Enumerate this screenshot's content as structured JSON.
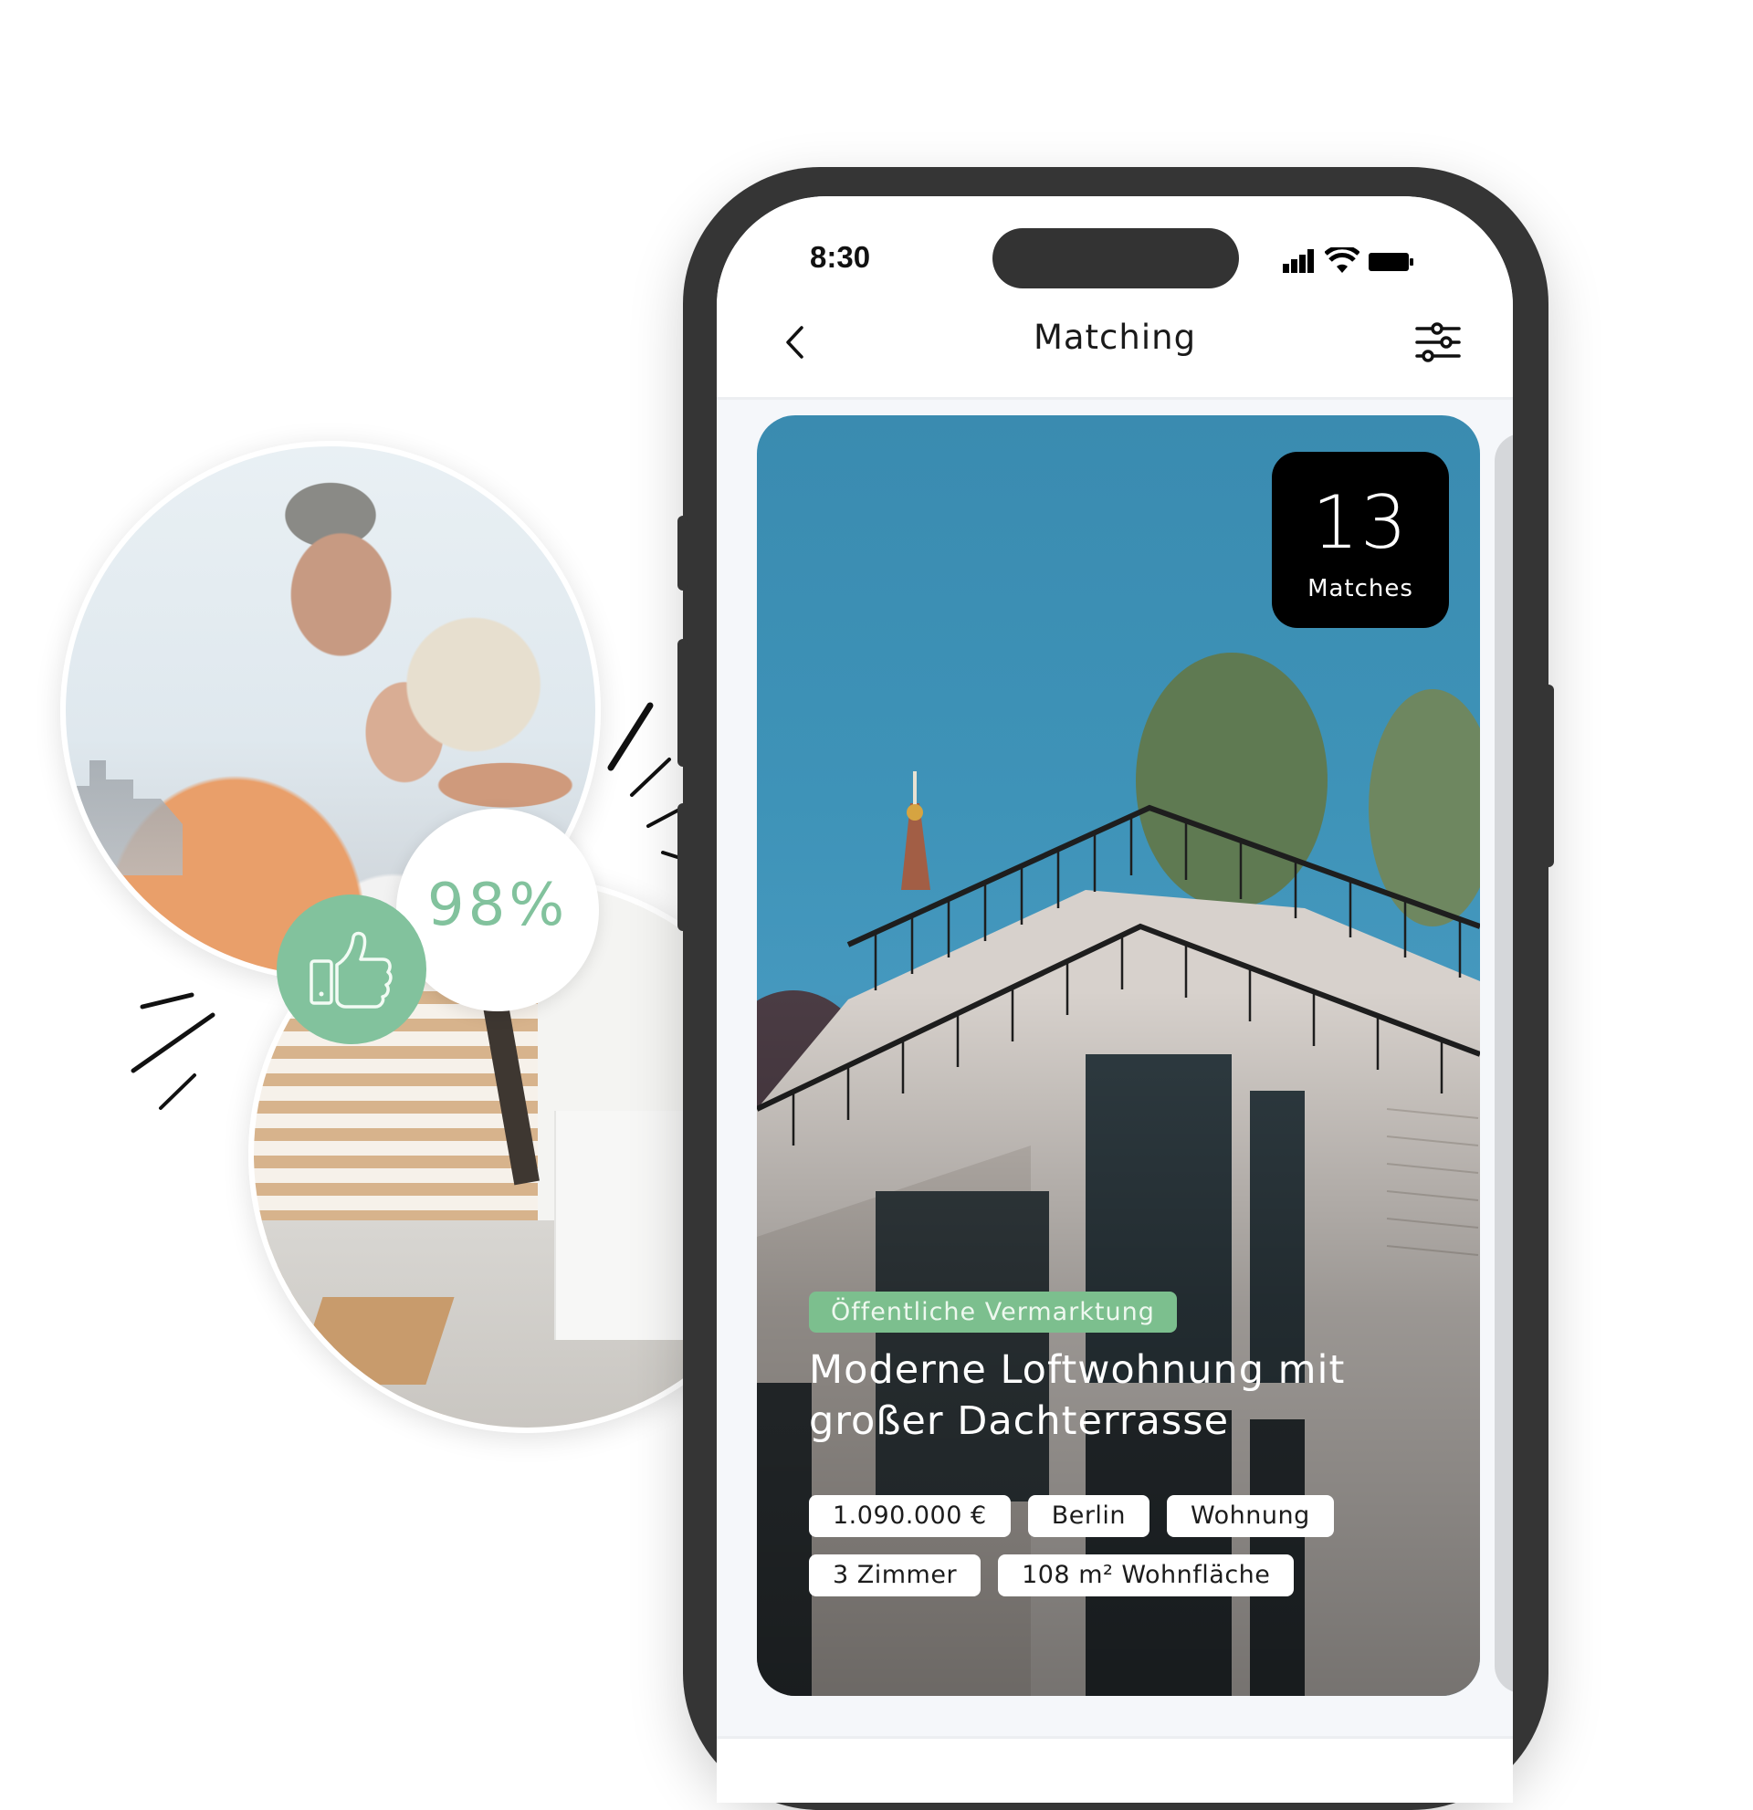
{
  "hero": {
    "match_percent": "98%",
    "thumb_icon": "thumbs-up-icon",
    "photos": [
      "couple-photo",
      "interior-photo"
    ]
  },
  "status_bar": {
    "time": "8:30",
    "icons": [
      "signal-icon",
      "wifi-icon",
      "battery-icon"
    ]
  },
  "header": {
    "title": "Matching",
    "back_icon": "chevron-left-icon",
    "filter_icon": "sliders-icon"
  },
  "listing": {
    "matches_count": "13",
    "matches_label": "Matches",
    "status": "Öffentliche Vermarktung",
    "title": "Moderne Loftwohnung mit großer Dachterrasse",
    "tags": [
      "1.090.000 €",
      "Berlin",
      "Wohnung",
      "3 Zimmer",
      "108 m² Wohnfläche"
    ]
  },
  "colors": {
    "accent_green": "#7cbf8e",
    "phone_frame": "#353535",
    "sky_blue": "#3e93b8"
  }
}
